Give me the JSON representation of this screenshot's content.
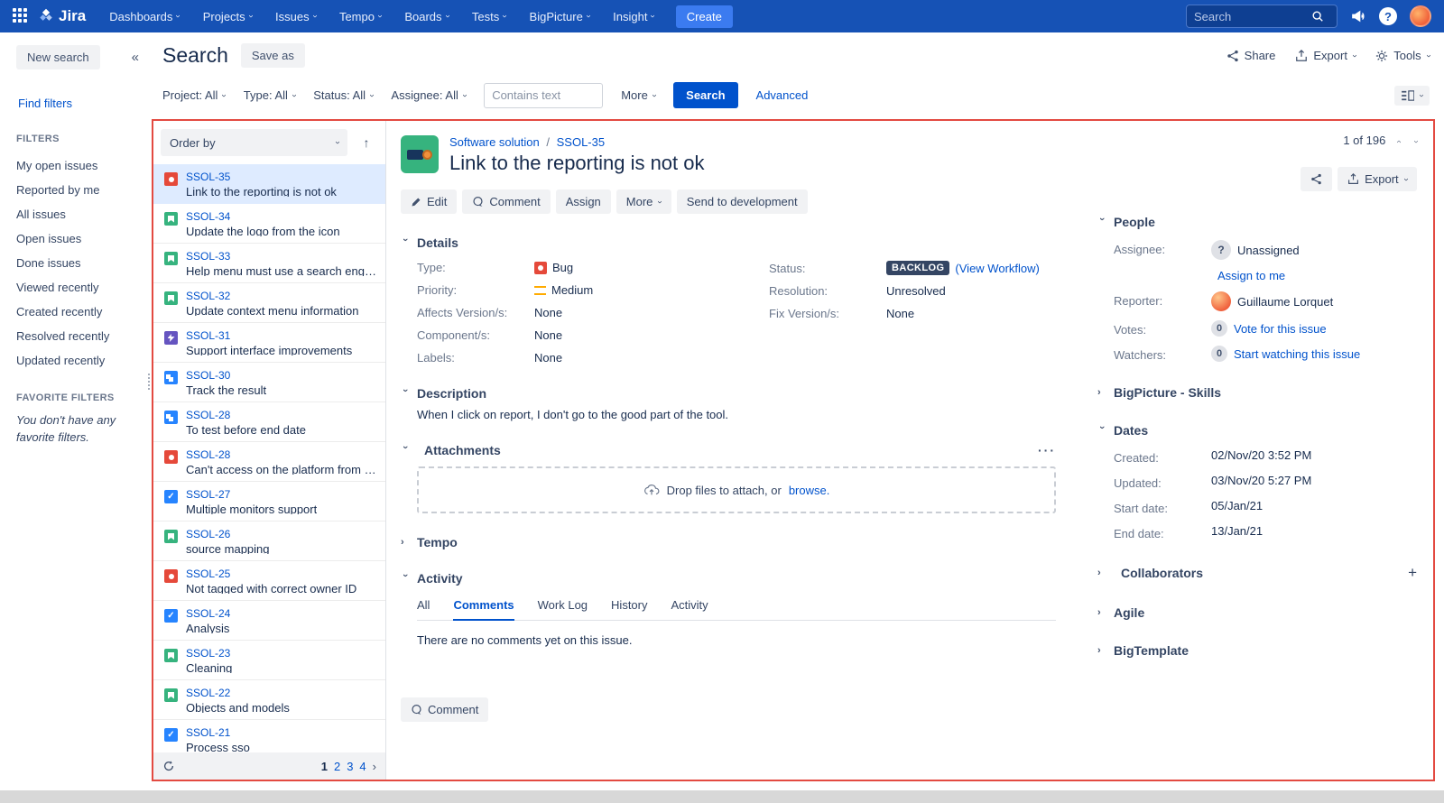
{
  "colors": {
    "navbar": "#1652b5",
    "link": "#0052cc",
    "selected_row": "#deebff",
    "bug": "#e5493a",
    "story": "#36b37e",
    "task": "#2684ff",
    "feature": "#6554c0",
    "change": "#2684ff",
    "status_badge": "#344563",
    "red_outline": "#e34a41",
    "priority_medium": "#ffab00"
  },
  "navbar": {
    "brand": "Jira",
    "menus": [
      "Dashboards",
      "Projects",
      "Issues",
      "Tempo",
      "Boards",
      "Tests",
      "BigPicture",
      "Insight"
    ],
    "create_label": "Create",
    "search_placeholder": "Search",
    "help_glyph": "?"
  },
  "sidebar": {
    "new_search_label": "New search",
    "collapse_glyph": "«",
    "find_filters_label": "Find filters",
    "filters_heading": "FILTERS",
    "filters": [
      "My open issues",
      "Reported by me",
      "All issues",
      "Open issues",
      "Done issues",
      "Viewed recently",
      "Created recently",
      "Resolved recently",
      "Updated recently"
    ],
    "favorites_heading": "FAVORITE FILTERS",
    "favorites_empty": "You don't have any favorite filters."
  },
  "search_header": {
    "title": "Search",
    "save_as_label": "Save as",
    "share_label": "Share",
    "export_label": "Export",
    "tools_label": "Tools"
  },
  "filter_bar": {
    "filters": [
      "Project: All",
      "Type: All",
      "Status: All",
      "Assignee: All"
    ],
    "contains_placeholder": "Contains text",
    "more_label": "More",
    "search_button": "Search",
    "advanced_label": "Advanced"
  },
  "issue_list": {
    "order_by_label": "Order by",
    "sort_glyph": "↑",
    "items": [
      {
        "key": "SSOL-35",
        "summary": "Link to the reporting is not ok",
        "type": "bug",
        "selected": true
      },
      {
        "key": "SSOL-34",
        "summary": "Update the logo from the icon",
        "type": "story"
      },
      {
        "key": "SSOL-33",
        "summary": "Help menu must use a search engine",
        "type": "story"
      },
      {
        "key": "SSOL-32",
        "summary": "Update context menu information",
        "type": "story"
      },
      {
        "key": "SSOL-31",
        "summary": "Support interface improvements",
        "type": "feature"
      },
      {
        "key": "SSOL-30",
        "summary": "Track the result",
        "type": "change"
      },
      {
        "key": "SSOL-28",
        "summary": "To test before end date",
        "type": "change"
      },
      {
        "key": "SSOL-28",
        "summary": "Can't access on the platform from my...",
        "type": "bug"
      },
      {
        "key": "SSOL-27",
        "summary": "Multiple monitors support",
        "type": "task"
      },
      {
        "key": "SSOL-26",
        "summary": "source mapping",
        "type": "story"
      },
      {
        "key": "SSOL-25",
        "summary": "Not tagged with correct owner ID",
        "type": "bug"
      },
      {
        "key": "SSOL-24",
        "summary": "Analysis",
        "type": "task"
      },
      {
        "key": "SSOL-23",
        "summary": "Cleaning",
        "type": "story"
      },
      {
        "key": "SSOL-22",
        "summary": "Objects and models",
        "type": "story"
      },
      {
        "key": "SSOL-21",
        "summary": "Process sso",
        "type": "task"
      }
    ],
    "pagination": {
      "pages": [
        "1",
        "2",
        "3",
        "4"
      ],
      "current": "1",
      "next": "›"
    }
  },
  "issue": {
    "project": "Software solution",
    "breadcrumb_sep": "/",
    "key": "SSOL-35",
    "title": "Link to the reporting is not ok",
    "pager": "1 of 196",
    "toolbar": {
      "edit": "Edit",
      "comment": "Comment",
      "assign": "Assign",
      "more": "More",
      "send_to_development": "Send to development",
      "export": "Export"
    },
    "details": {
      "heading": "Details",
      "type_label": "Type:",
      "type_value": "Bug",
      "priority_label": "Priority:",
      "priority_value": "Medium",
      "affects_label": "Affects Version/s:",
      "affects_value": "None",
      "component_label": "Component/s:",
      "component_value": "None",
      "labels_label": "Labels:",
      "labels_value": "None",
      "status_label": "Status:",
      "status_value": "BACKLOG",
      "status_link": "(View Workflow)",
      "resolution_label": "Resolution:",
      "resolution_value": "Unresolved",
      "fix_label": "Fix Version/s:",
      "fix_value": "None"
    },
    "description": {
      "heading": "Description",
      "text": "When I click on report, I don't go to the good part of the tool."
    },
    "attachments": {
      "heading": "Attachments",
      "menu_glyph": "···",
      "drop_text": "Drop files to attach, or",
      "browse_link": "browse."
    },
    "tempo_heading": "Tempo",
    "activity": {
      "heading": "Activity",
      "tabs": [
        "All",
        "Comments",
        "Work Log",
        "History",
        "Activity"
      ],
      "active_tab": "Comments",
      "empty_text": "There are no comments yet on this issue.",
      "comment_button": "Comment"
    }
  },
  "people": {
    "heading": "People",
    "assignee_label": "Assignee:",
    "assignee_value": "Unassigned",
    "assignee_glyph": "?",
    "assign_to_me": "Assign to me",
    "reporter_label": "Reporter:",
    "reporter_value": "Guillaume Lorquet",
    "votes_label": "Votes:",
    "votes_count": "0",
    "votes_link": "Vote for this issue",
    "watchers_label": "Watchers:",
    "watchers_count": "0",
    "watchers_link": "Start watching this issue"
  },
  "dates": {
    "heading": "Dates",
    "rows": [
      {
        "label": "Created:",
        "value": "02/Nov/20 3:52 PM"
      },
      {
        "label": "Updated:",
        "value": "03/Nov/20 5:27 PM"
      },
      {
        "label": "Start date:",
        "value": "05/Jan/21"
      },
      {
        "label": "End date:",
        "value": "13/Jan/21"
      }
    ]
  },
  "right_sections": {
    "bigpicture_skills": "BigPicture - Skills",
    "collaborators": "Collaborators",
    "collaborators_add": "+",
    "agile": "Agile",
    "bigtemplate": "BigTemplate"
  }
}
